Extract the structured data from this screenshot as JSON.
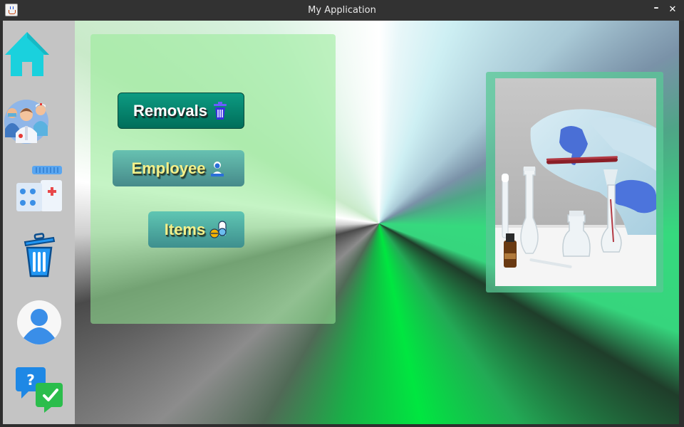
{
  "window": {
    "title": "My Application",
    "minimize_glyph": "–",
    "close_glyph": "✕"
  },
  "sidebar": {
    "items": [
      {
        "name": "home",
        "icon": "home-icon"
      },
      {
        "name": "employees",
        "icon": "medical-staff-icon"
      },
      {
        "name": "items",
        "icon": "medicine-icon"
      },
      {
        "name": "removals",
        "icon": "trash-icon"
      },
      {
        "name": "profile",
        "icon": "user-icon"
      },
      {
        "name": "help",
        "icon": "help-chat-icon"
      }
    ]
  },
  "menu": {
    "removals_label": "Removals",
    "employee_label": "Employee",
    "items_label": "Items"
  },
  "colors": {
    "home_icon": "#1ad1dd",
    "removals_button": "#00806a",
    "button_text": "#f4f08a",
    "panel": "#96eb96"
  }
}
